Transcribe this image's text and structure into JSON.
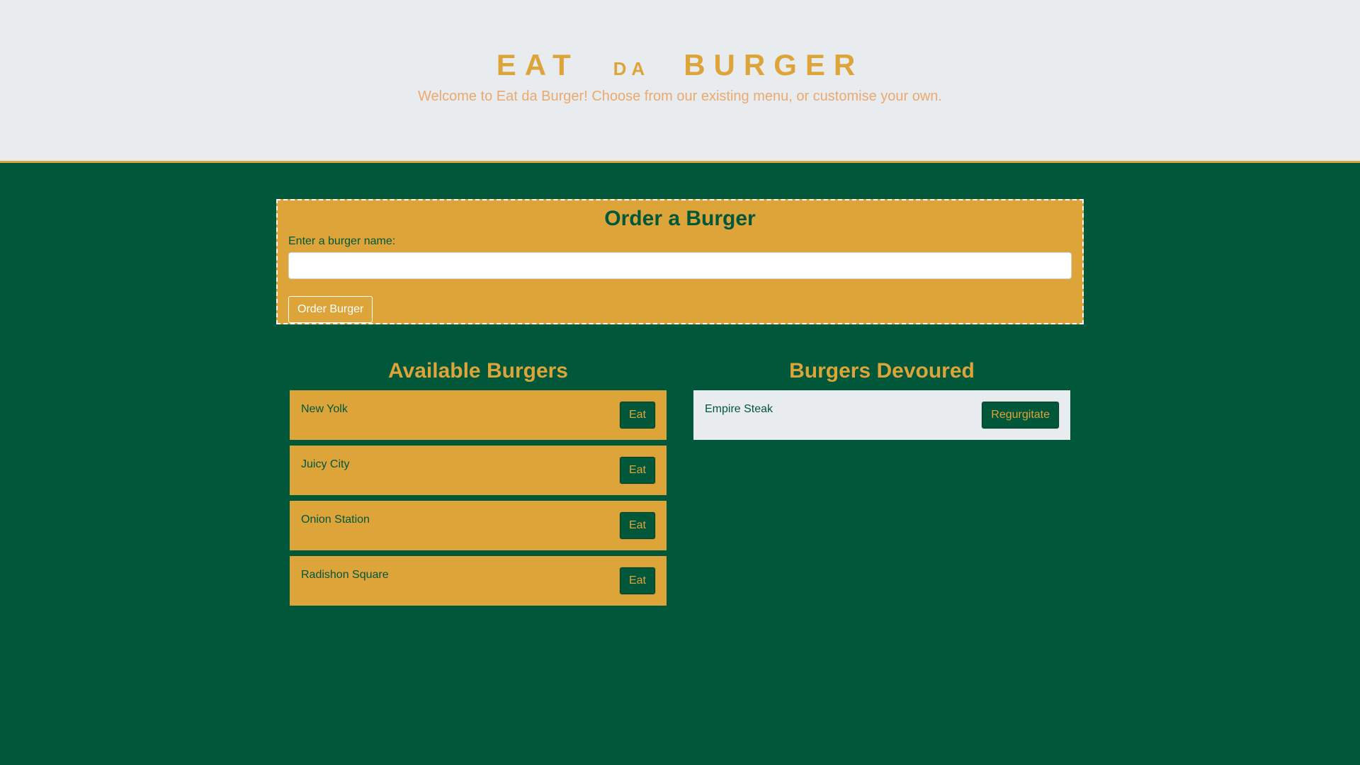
{
  "header": {
    "title_word_1": "EAT",
    "title_word_2": "DA",
    "title_word_3": "BURGER",
    "subtitle": "Welcome to Eat da Burger! Choose from our existing menu, or customise your own."
  },
  "order_form": {
    "title": "Order a Burger",
    "label": "Enter a burger name:",
    "input_value": "",
    "button_label": "Order Burger"
  },
  "available": {
    "title": "Available Burgers",
    "items": [
      {
        "name": "New Yolk",
        "button_label": "Eat"
      },
      {
        "name": "Juicy City",
        "button_label": "Eat"
      },
      {
        "name": "Onion Station",
        "button_label": "Eat"
      },
      {
        "name": "Radishon Square",
        "button_label": "Eat"
      }
    ]
  },
  "devoured": {
    "title": "Burgers Devoured",
    "items": [
      {
        "name": "Empire Steak",
        "button_label": "Regurgitate"
      }
    ]
  },
  "colors": {
    "primary_green": "#00573a",
    "mustard": "#dda43a",
    "light_gray": "#e9ecef",
    "subtitle_orange": "#eba96f"
  }
}
